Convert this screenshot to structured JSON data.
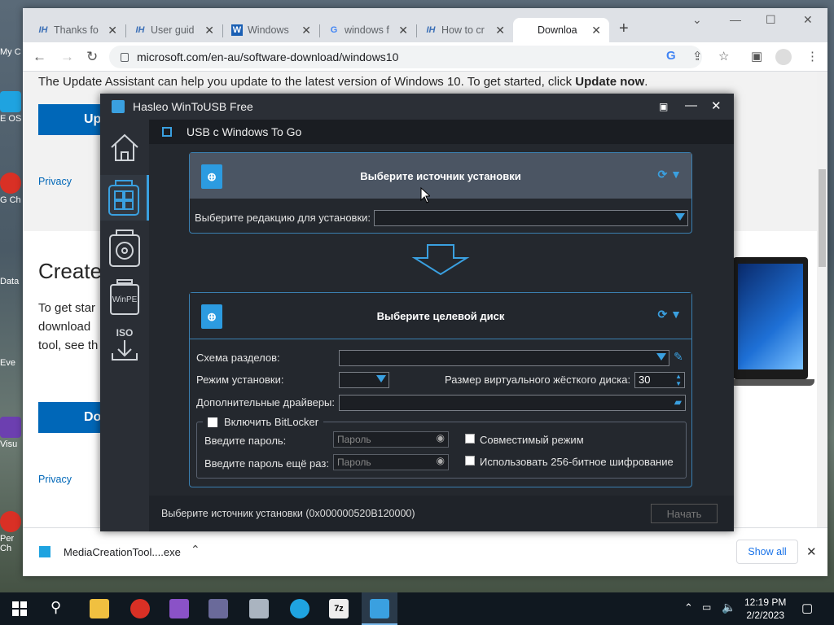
{
  "desktop": {
    "icons": [
      "My C",
      "E OS",
      "G Ch",
      "Data",
      "Eve",
      "Visu",
      "Per Ch"
    ]
  },
  "browser": {
    "tabs": [
      {
        "label": "Thanks fo",
        "favicon": "IH"
      },
      {
        "label": "User guid",
        "favicon": "IH"
      },
      {
        "label": "Windows",
        "favicon": "W"
      },
      {
        "label": "windows f",
        "favicon": "G"
      },
      {
        "label": "How to cr",
        "favicon": "IH"
      },
      {
        "label": "Downloa",
        "favicon": "ms"
      }
    ],
    "url": "microsoft.com/en-au/software-download/windows10",
    "page": {
      "intro": "The Update Assistant can help you update to the latest version of Windows 10. To get started, click ",
      "intro_bold": "Update now",
      "intro_end": ".",
      "update_btn": "Up",
      "privacy1": "Privacy",
      "create_heading": "Create",
      "body1": "To get star",
      "body2": "download",
      "body3": "tool, see th",
      "download_btn": "Do",
      "privacy2": "Privacy"
    },
    "download": {
      "file": "MediaCreationTool....exe",
      "show_all": "Show all"
    }
  },
  "app": {
    "title": "Hasleo WinToUSB Free",
    "subheader": "USB с Windows To Go",
    "sidebar": {
      "winpe": "WinPE",
      "iso": "ISO"
    },
    "source": {
      "heading": "Выберите источник установки",
      "edition_label": "Выберите редакцию для установки:"
    },
    "target": {
      "heading": "Выберите целевой диск",
      "partition_label": "Схема разделов:",
      "mode_label": "Режим установки:",
      "vhd_label": "Размер виртуального жёсткого диска:",
      "vhd_value": "30",
      "drivers_label": "Дополнительные драйверы:",
      "bitlocker_label": "Включить BitLocker",
      "pwd_label": "Введите пароль:",
      "pwd2_label": "Введите пароль ещё раз:",
      "pwd_placeholder": "Пароль",
      "compat_label": "Совместимый режим",
      "aes256_label": "Использовать 256-битное шифрование"
    },
    "status": "Выберите источник установки (0x000000520B120000)",
    "start_btn": "Начать"
  },
  "taskbar": {
    "time": "12:19 PM",
    "date": "2/2/2023"
  }
}
